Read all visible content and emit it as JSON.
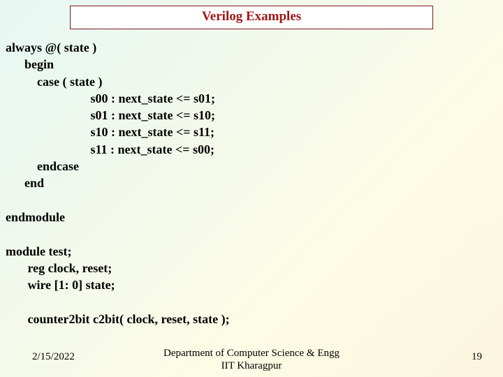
{
  "title": "Verilog Examples",
  "code": "always @( state )\n      begin\n          case ( state )\n                           s00 : next_state <= s01;\n                           s01 : next_state <= s10;\n                           s10 : next_state <= s11;\n                           s11 : next_state <= s00;\n          endcase\n      end\n\nendmodule\n\nmodule test;\n       reg clock, reset;\n       wire [1: 0] state;\n\n       counter2bit c2bit( clock, reset, state );",
  "footer": {
    "date": "2/15/2022",
    "center_line1": "Department of Computer Science & Engg",
    "center_line2": "IIT Kharagpur",
    "page": "19"
  }
}
